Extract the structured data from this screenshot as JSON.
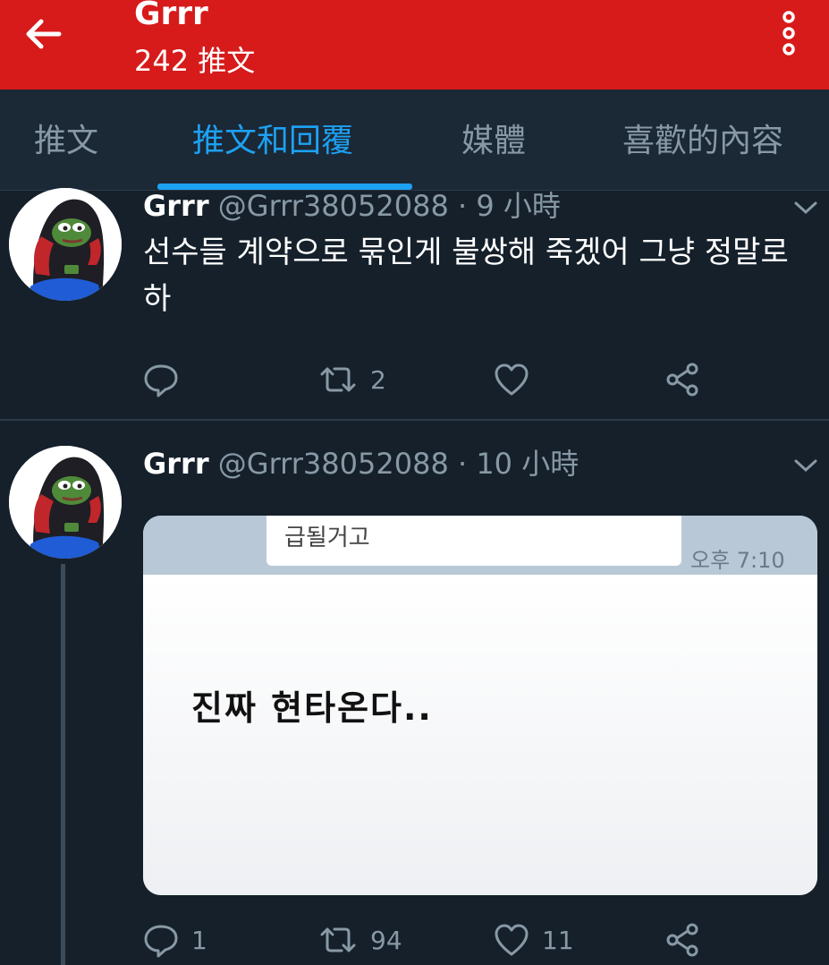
{
  "header": {
    "title": "Grrr",
    "subtitle": "242 推文",
    "bg_color": "#d71a1a"
  },
  "tabs": [
    {
      "label": "推文",
      "active": false
    },
    {
      "label": "推文和回覆",
      "active": true
    },
    {
      "label": "媒體",
      "active": false
    },
    {
      "label": "喜歡的內容",
      "active": false
    }
  ],
  "accent_color": "#1da1f2",
  "tweets": [
    {
      "name": "Grrr",
      "handle": "@Grrr38052088",
      "separator": "·",
      "time": "9 小時",
      "text": "선수들 계약으로 묶인게 불쌍해 죽겠어 그냥 정말로 하",
      "counts": {
        "reply": "",
        "retweet": "2",
        "like": "",
        "share": ""
      }
    },
    {
      "name": "Grrr",
      "handle": "@Grrr38052088",
      "separator": "·",
      "time": "10 小時",
      "media": {
        "bubble_text": "급될거고",
        "timestamp": "오후 7:10",
        "message": "진짜  현타온다.."
      },
      "counts": {
        "reply": "1",
        "retweet": "94",
        "like": "11",
        "share": ""
      }
    }
  ],
  "icons": [
    "back-arrow-icon",
    "more-vertical-icon",
    "chevron-down-icon",
    "reply-icon",
    "retweet-icon",
    "like-icon",
    "share-icon"
  ]
}
